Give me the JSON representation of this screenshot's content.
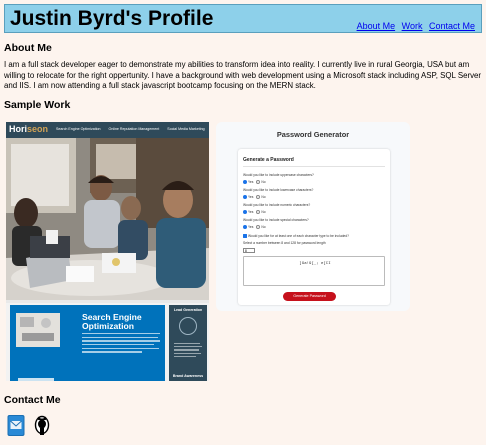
{
  "header": {
    "title": "Justin Byrd's Profile",
    "nav": [
      "About Me",
      "Work",
      "Contact Me"
    ]
  },
  "about": {
    "heading": "About Me",
    "text": "I am a full stack developer eager to demonstrate my abilities to transform idea into reality. I currently live in rural Georgia, USA but am willing to relocate for the right oppertunity. I have a background with web development using a Microsoft stack including ASP, SQL Server and IIS. I am now attending a full stack javascript bootcamp focusing on the MERN stack."
  },
  "work": {
    "heading": "Sample Work",
    "project1": {
      "logo_prefix": "Hori",
      "logo_suffix": "seon",
      "nav": [
        "Search Engine Optimization",
        "Online Reputation Management",
        "Social Media Marketing"
      ],
      "section_title": "Search Engine Optimization",
      "side_title": "Lead Generation",
      "side_title2": "Brand Awareness"
    },
    "project2": {
      "title": "Password Generator",
      "card_title": "Generate a Password",
      "questions": [
        "Would you like to include uppercase characters?",
        "Would you like to include lowercase characters?",
        "Would you like to include numeric characters?",
        "Would you like to include special characters?"
      ],
      "yes_label": "Yes",
      "no_label": "No",
      "require_text": "Would you like for at least one of each character type to be included?",
      "length_text": "Select a number between 8 and 128 for password length",
      "length_value": "8",
      "output": "]Ga!9[_; e[CI",
      "button": "Generate Password"
    }
  },
  "contact": {
    "heading": "Contact Me",
    "icons": [
      "email-icon",
      "github-icon"
    ]
  },
  "colors": {
    "page_bg": "#fdf4ee",
    "header_bg": "#8dd0ea",
    "link": "#0000ee",
    "horiseon_dark": "#2f4a5a",
    "horiseon_blue": "#0072bb",
    "button_red": "#c6111c"
  }
}
